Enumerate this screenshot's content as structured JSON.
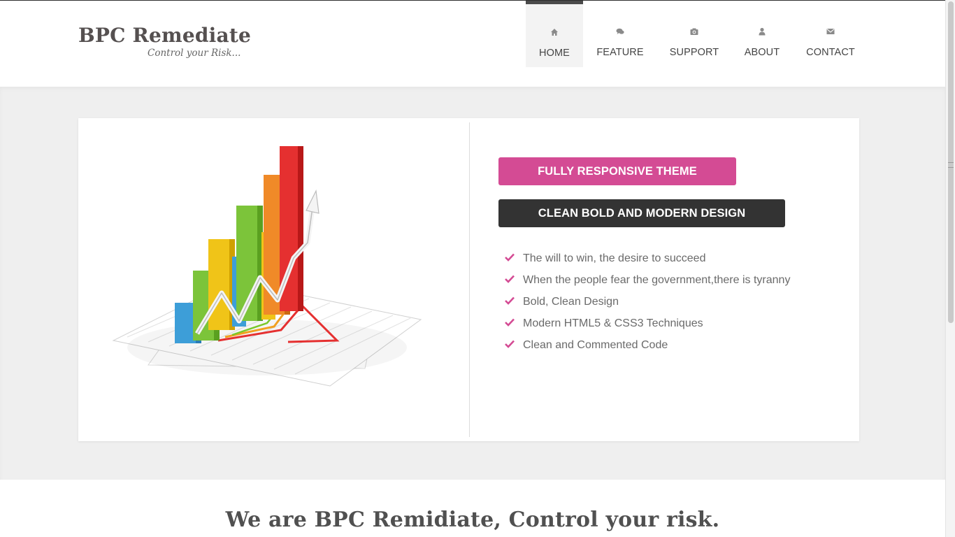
{
  "brand": {
    "title": "BPC Remediate",
    "tagline": "Control your Risk..."
  },
  "nav": {
    "items": [
      {
        "label": "HOME",
        "icon": "home-icon",
        "active": true
      },
      {
        "label": "FEATURE",
        "icon": "comments-icon",
        "active": false
      },
      {
        "label": "SUPPORT",
        "icon": "camera-icon",
        "active": false
      },
      {
        "label": "ABOUT",
        "icon": "user-icon",
        "active": false
      },
      {
        "label": "CONTACT",
        "icon": "envelope-icon",
        "active": false
      }
    ]
  },
  "hero": {
    "badge_primary": "FULLY RESPONSIVE THEME",
    "badge_secondary": "CLEAN BOLD AND MODERN DESIGN",
    "features": [
      "The will to win, the desire to succeed",
      "When the people fear the government,there is tyranny",
      "Bold, Clean Design",
      "Modern HTML5 & CSS3 Techniques",
      "Clean and Commented Code"
    ],
    "illustration": "3d-bar-chart-illustration"
  },
  "section": {
    "heading": "We are BPC Remidiate, Control your risk."
  },
  "colors": {
    "accent_pink": "#d44b94",
    "dark": "#333333",
    "band_bg": "#efefef"
  }
}
